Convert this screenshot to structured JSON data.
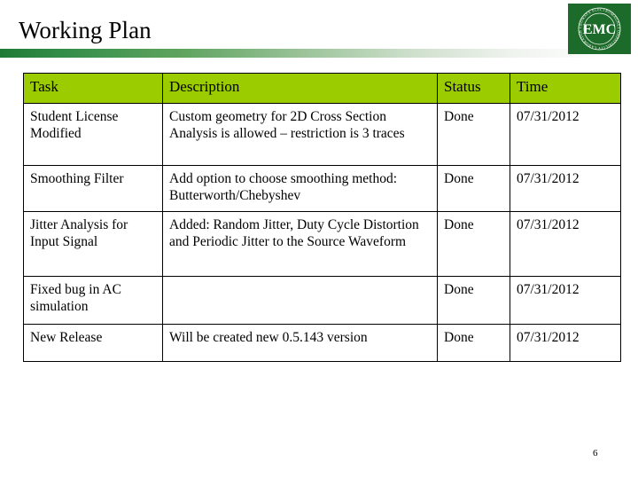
{
  "slide": {
    "title": "Working Plan",
    "page_number": "6",
    "accent_green": "#9ACC00",
    "rule_green": "#1e7a34",
    "status_green": "#1d5b21",
    "logo_green": "#1d6b2a"
  },
  "logo": {
    "center_text": "EMC",
    "arc_top_text": "MICROWAVE  ELECTROMAGNETIC",
    "arc_bottom_text": "COMPATIBILITY  LABORATORY"
  },
  "table": {
    "columns": [
      "Task",
      "Description",
      "Status",
      "Time"
    ],
    "rows": [
      {
        "task": "Student License Modified",
        "description": "Custom geometry for 2D Cross Section Analysis is allowed – restriction is 3 traces",
        "status": "Done",
        "time": "07/31/2012"
      },
      {
        "task": "Smoothing Filter",
        "description": "Add option to choose smoothing method: Butterworth/Chebyshev",
        "status": "Done",
        "time": "07/31/2012"
      },
      {
        "task": "Jitter Analysis for Input Signal",
        "description": "Added: Random Jitter, Duty Cycle Distortion and Periodic Jitter to the Source Waveform",
        "status": "Done",
        "time": "07/31/2012"
      },
      {
        "task": "Fixed bug in AC simulation",
        "description": "",
        "status": "Done",
        "time": "07/31/2012"
      },
      {
        "task": "New Release",
        "description": "Will be created new 0.5.143 version",
        "status": "Done",
        "time": "07/31/2012"
      }
    ]
  }
}
